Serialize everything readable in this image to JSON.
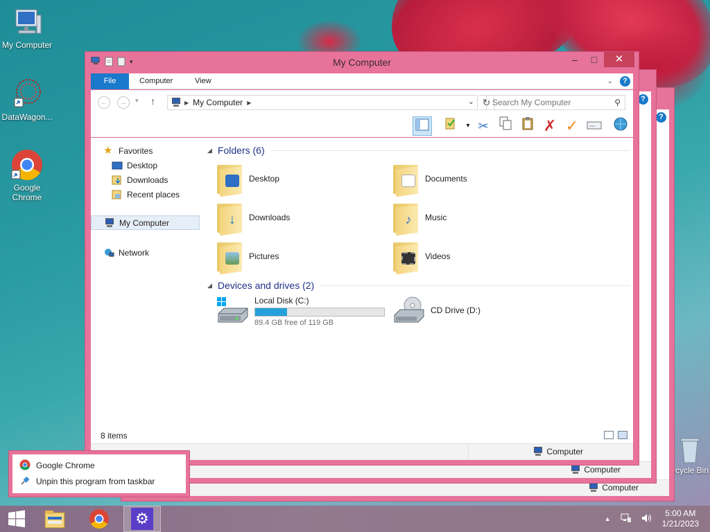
{
  "desktop": {
    "icons": [
      {
        "label": "My Computer"
      },
      {
        "label": "DataWagon..."
      },
      {
        "label": "Google Chrome"
      },
      {
        "label": "Recycle Bin"
      }
    ]
  },
  "window": {
    "title": "My Computer",
    "ribbon_tabs": [
      "File",
      "Computer",
      "View"
    ],
    "address": "My Computer",
    "search_placeholder": "Search My Computer",
    "nav": {
      "favorites": "Favorites",
      "favorites_items": [
        "Desktop",
        "Downloads",
        "Recent places"
      ],
      "computer": "My Computer",
      "network": "Network"
    },
    "folders_header": "Folders (6)",
    "folders": [
      {
        "name": "Desktop",
        "icon": "desktop-folder-icon"
      },
      {
        "name": "Documents",
        "icon": "documents-folder-icon"
      },
      {
        "name": "Downloads",
        "icon": "downloads-folder-icon"
      },
      {
        "name": "Music",
        "icon": "music-folder-icon"
      },
      {
        "name": "Pictures",
        "icon": "pictures-folder-icon"
      },
      {
        "name": "Videos",
        "icon": "videos-folder-icon"
      }
    ],
    "devices_header": "Devices and drives (2)",
    "drives": [
      {
        "name": "Local Disk (C:)",
        "free": "89.4 GB free of 119 GB",
        "used_fraction": 0.249
      },
      {
        "name": "CD Drive (D:)"
      }
    ],
    "status_count": "8 items",
    "status_location": "Computer"
  },
  "back_windows": [
    {
      "status_location": "Computer"
    },
    {
      "status_location": "Computer"
    }
  ],
  "jumplist": {
    "items": [
      "Google Chrome",
      "Unpin this program from taskbar"
    ]
  },
  "taskbar": {
    "time": "5:00 AM",
    "date": "1/21/2023"
  },
  "colors": {
    "window_frame": "#e7739b",
    "ribbon_file_tab": "#1979ca",
    "close_button": "#c7415b",
    "progress_fill": "#26a0da",
    "group_header": "#1e3287"
  }
}
